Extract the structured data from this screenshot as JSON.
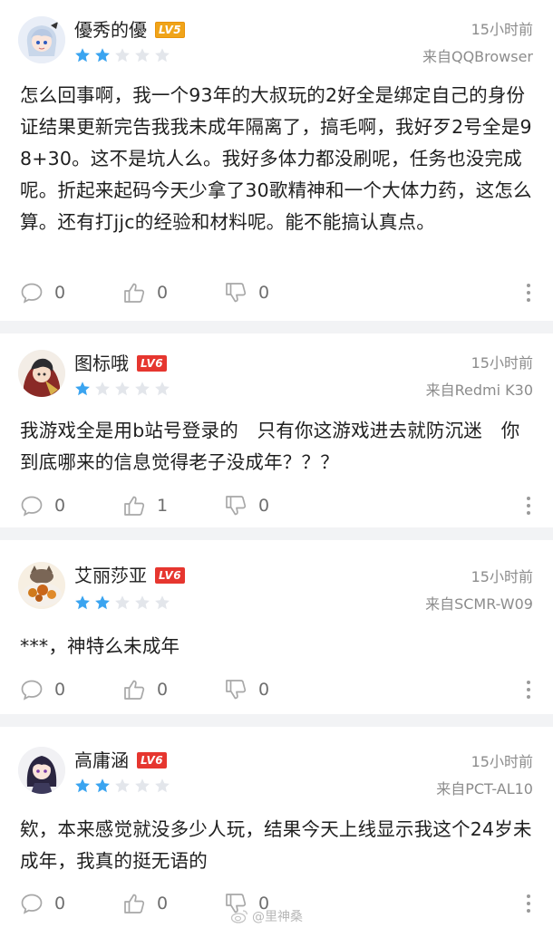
{
  "comments": [
    {
      "username": "優秀的優",
      "level": "LV5",
      "rating": 2,
      "time": "15小时前",
      "source": "来自QQBrowser",
      "text": "怎么回事啊，我一个93年的大叔玩的2好全是绑定自己的身份证结果更新完告我我未成年隔离了，搞毛啊，我好歹2号全是98+30。这不是坑人么。我好多体力都没刷呢，任务也没完成呢。折起来起码今天少拿了30歌精神和一个大体力药，这怎么算。还有打jjc的经验和材料呢。能不能搞认真点。",
      "comments_count": "0",
      "likes": "0",
      "dislikes": "0"
    },
    {
      "username": "图标哦",
      "level": "LV6",
      "rating": 1,
      "time": "15小时前",
      "source": "来自Redmi K30",
      "text": "我游戏全是用b站号登录的　只有你这游戏进去就防沉迷　你到底哪来的信息觉得老子没成年？？？",
      "comments_count": "0",
      "likes": "1",
      "dislikes": "0"
    },
    {
      "username": "艾丽莎亚",
      "level": "LV6",
      "rating": 2,
      "time": "15小时前",
      "source": "来自SCMR-W09",
      "text": "***，神特么未成年",
      "comments_count": "0",
      "likes": "0",
      "dislikes": "0"
    },
    {
      "username": "高庸涵",
      "level": "LV6",
      "rating": 2,
      "time": "15小时前",
      "source": "来自PCT-AL10",
      "text": "欸，本来感觉就没多少人玩，结果今天上线显示我这个24岁未成年，我真的挺无语的",
      "comments_count": "0",
      "likes": "0",
      "dislikes": "0"
    }
  ],
  "watermark": "@里神桑",
  "colors": {
    "star_filled": "#3aa4f0",
    "star_empty": "#e3e6eb",
    "separator": "#f2f3f5",
    "level_badge_red": "#e6362f",
    "level_badge_orange": "#f0a419"
  },
  "icons": [
    "comment-icon",
    "thumb-up-icon",
    "thumb-down-icon",
    "more-icon",
    "star-icon",
    "weibo-icon"
  ]
}
